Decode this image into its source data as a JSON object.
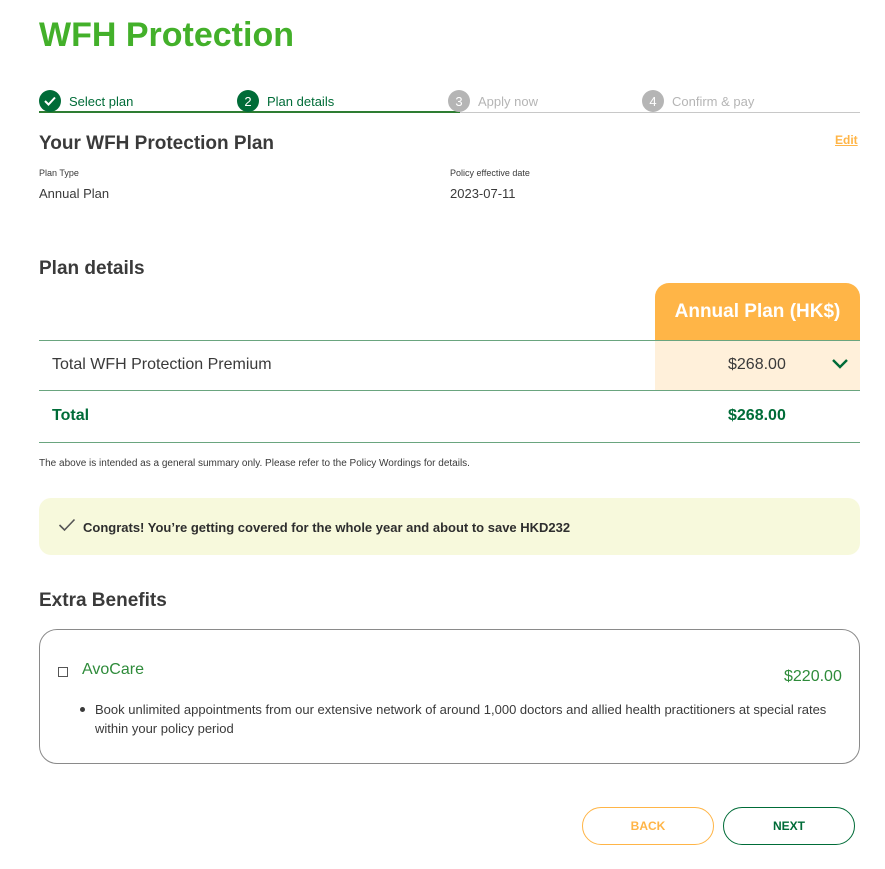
{
  "page": {
    "title": "WFH Protection"
  },
  "stepper": {
    "steps": [
      {
        "number": "✓",
        "label": "Select plan",
        "state": "done"
      },
      {
        "number": "2",
        "label": "Plan details",
        "state": "current"
      },
      {
        "number": "3",
        "label": "Apply now",
        "state": "todo"
      },
      {
        "number": "4",
        "label": "Confirm & pay",
        "state": "todo"
      }
    ]
  },
  "plan_summary": {
    "heading": "Your WFH Protection Plan",
    "edit_label": "Edit",
    "plan_type_label": "Plan Type",
    "plan_type_value": "Annual Plan",
    "effective_date_label": "Policy effective date",
    "effective_date_value": "2023-07-11"
  },
  "plan_details": {
    "heading": "Plan details",
    "column_header": "Annual Plan (HK$)",
    "rows": [
      {
        "label": "Total WFH Protection Premium",
        "value": "$268.00"
      }
    ],
    "total_label": "Total",
    "total_value": "$268.00",
    "disclaimer": "The above is intended as a general summary only. Please refer to the Policy Wordings for details."
  },
  "congrats": {
    "text": "Congrats! You’re getting covered for the whole year and about to save HKD232"
  },
  "extra_benefits": {
    "heading": "Extra Benefits",
    "items": [
      {
        "name": "AvoCare",
        "price": "$220.00",
        "checked": false,
        "points": [
          "Book unlimited appointments from our extensive network of around 1,000 doctors and allied health practitioners at special rates within your policy period"
        ]
      }
    ]
  },
  "actions": {
    "back_label": "BACK",
    "next_label": "NEXT"
  },
  "colors": {
    "brand_green": "#43b02a",
    "dark_green": "#006c38",
    "accent_orange": "#ffb547",
    "premium_highlight": "#fff0da",
    "congrats_bg": "#f7f9dc"
  }
}
